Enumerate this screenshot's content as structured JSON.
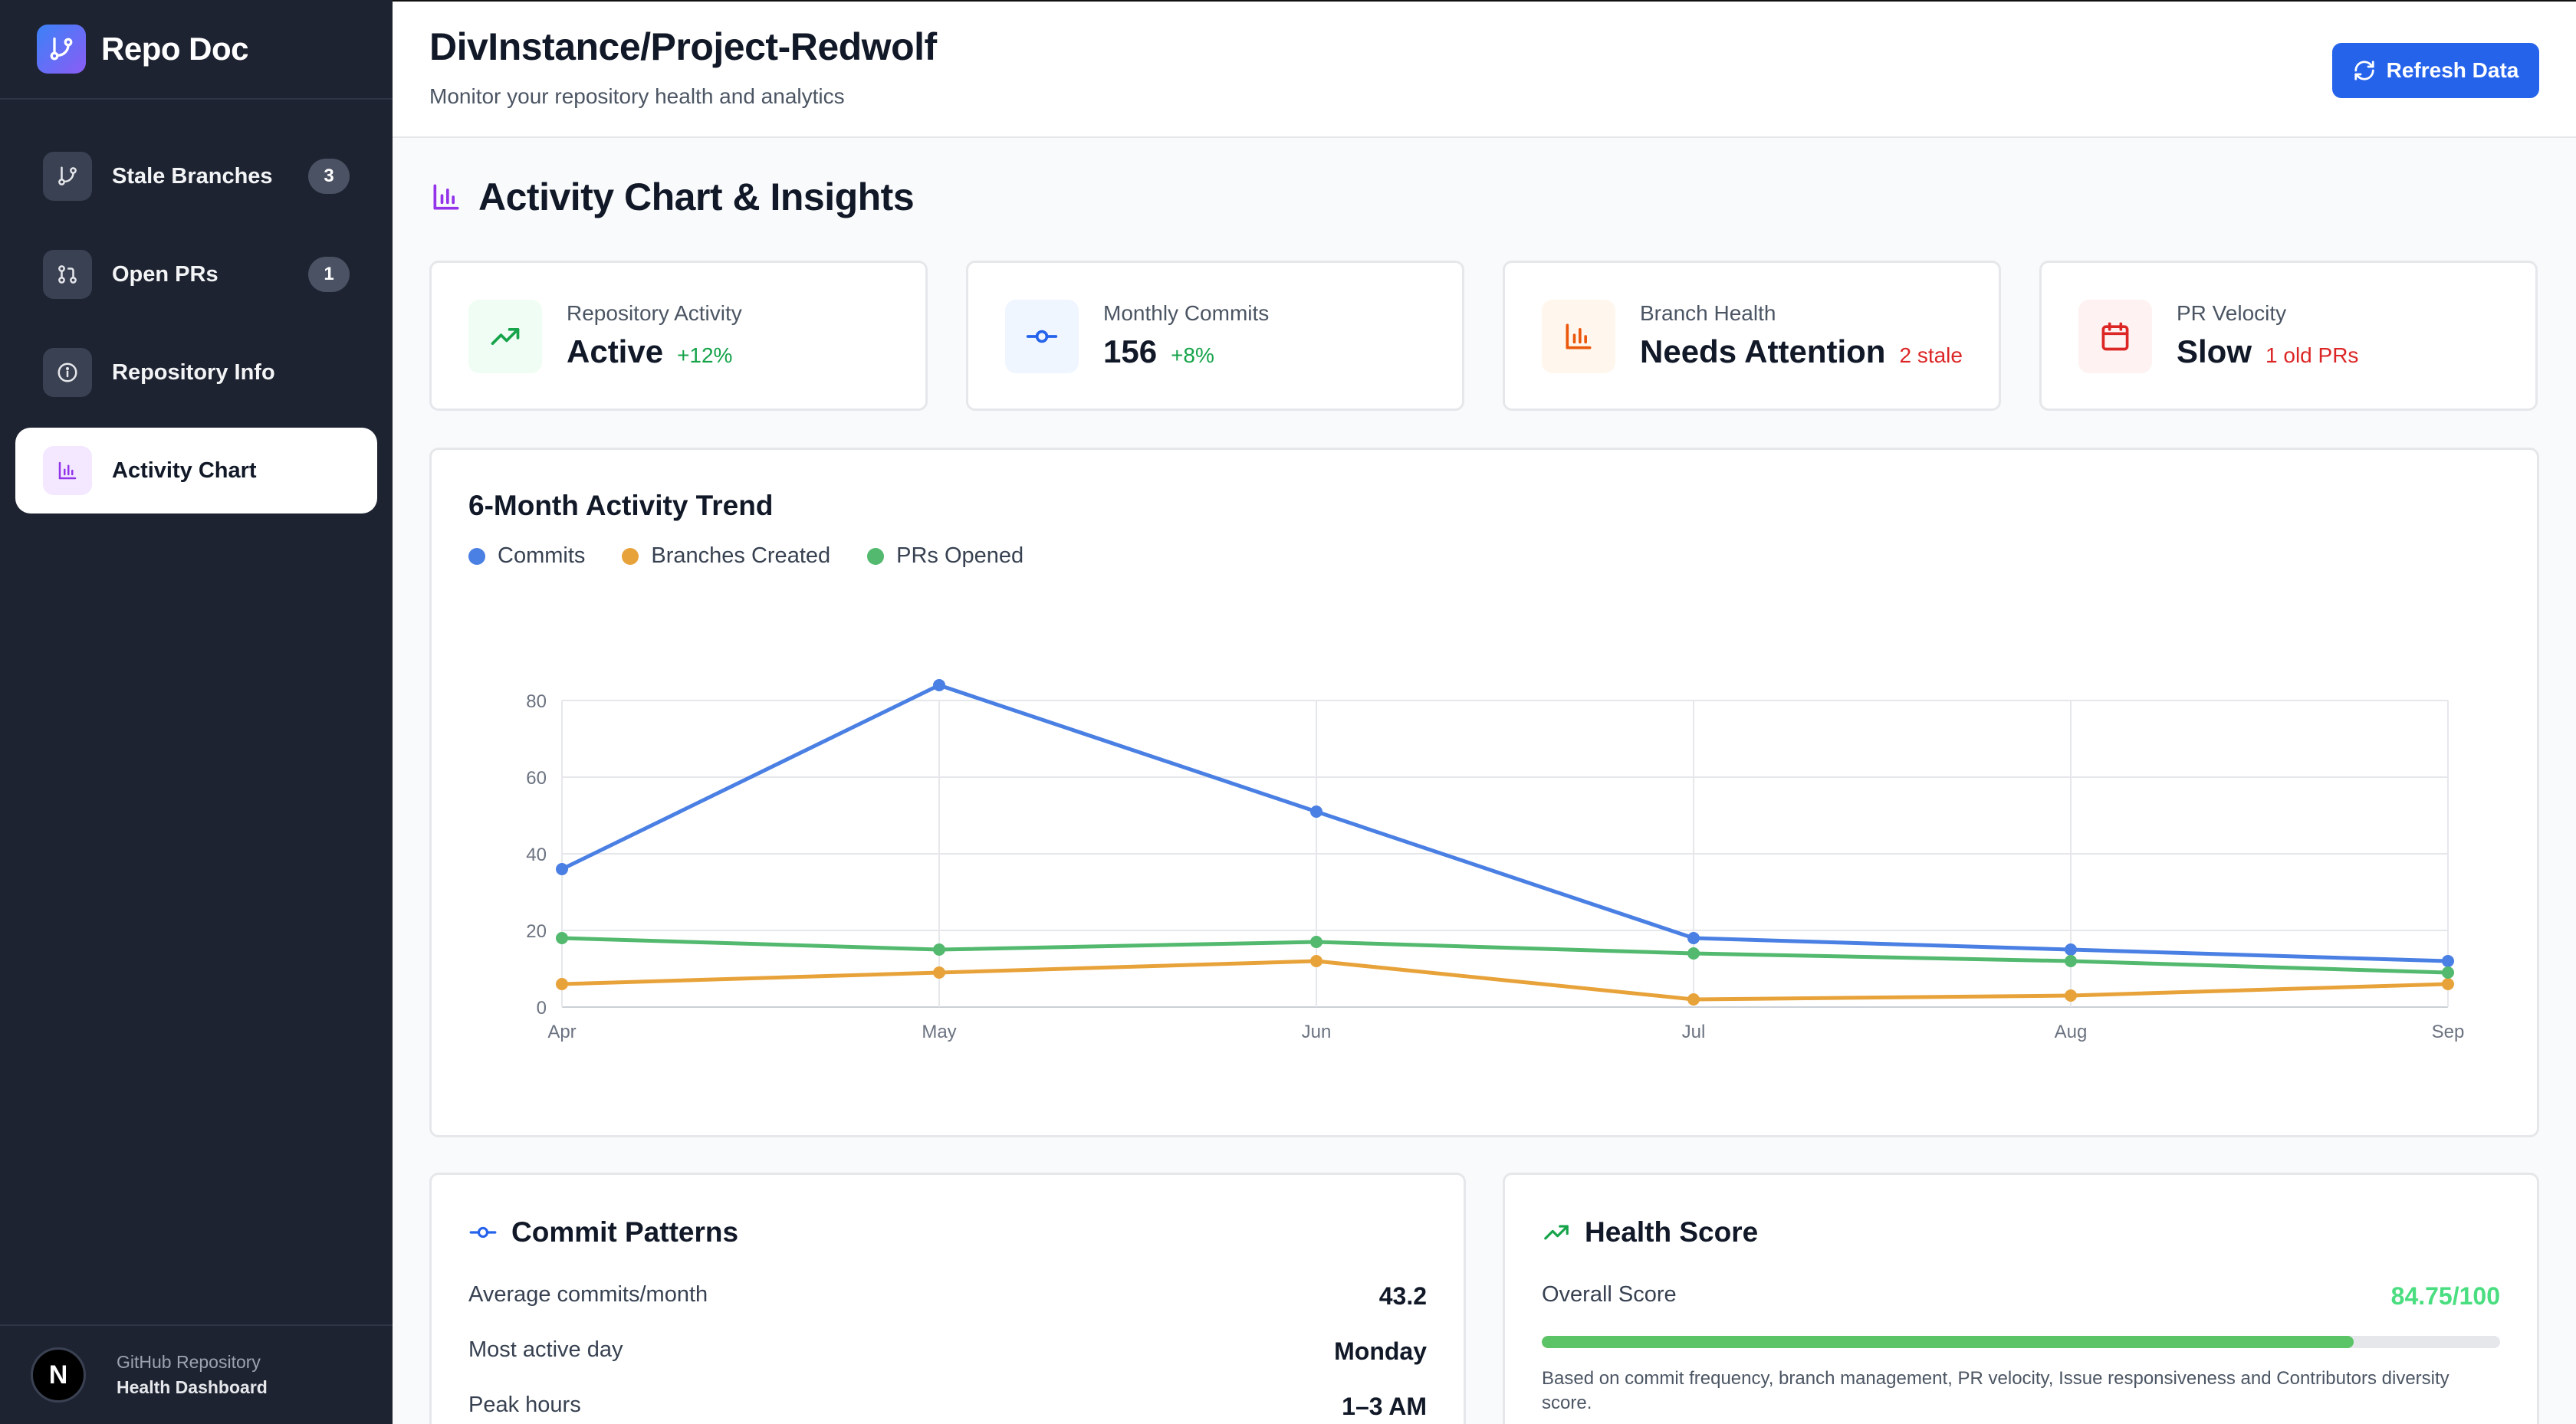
{
  "app": {
    "name": "Repo Doc"
  },
  "sidebar": {
    "items": [
      {
        "label": "Stale Branches",
        "badge": "3",
        "icon": "git-branch-icon"
      },
      {
        "label": "Open PRs",
        "badge": "1",
        "icon": "git-pull-request-icon"
      },
      {
        "label": "Repository Info",
        "icon": "info-icon"
      },
      {
        "label": "Activity Chart",
        "icon": "bar-chart-icon",
        "active": true
      }
    ],
    "footer": {
      "avatar_letter": "N",
      "line1": "GitHub Repository",
      "line2": "Health Dashboard"
    }
  },
  "header": {
    "title": "DivInstance/Project-Redwolf",
    "subtitle": "Monitor your repository health and analytics",
    "refresh_label": "Refresh Data"
  },
  "section": {
    "title": "Activity Chart & Insights"
  },
  "stats": [
    {
      "label": "Repository Activity",
      "value": "Active",
      "delta": "+12%",
      "delta_color": "#16a34a",
      "icon": "trending-up-icon",
      "icon_bg": "#f0fdf4",
      "icon_color": "#16a34a"
    },
    {
      "label": "Monthly Commits",
      "value": "156",
      "delta": "+8%",
      "delta_color": "#16a34a",
      "icon": "git-commit-icon",
      "icon_bg": "#eff6ff",
      "icon_color": "#2563eb"
    },
    {
      "label": "Branch Health",
      "value": "Needs Attention",
      "delta": "2 stale",
      "delta_color": "#dc2626",
      "icon": "bar-chart-icon",
      "icon_bg": "#fff7ed",
      "icon_color": "#ea580c"
    },
    {
      "label": "PR Velocity",
      "value": "Slow",
      "delta": "1 old PRs",
      "delta_color": "#dc2626",
      "icon": "calendar-icon",
      "icon_bg": "#fef2f2",
      "icon_color": "#dc2626"
    }
  ],
  "chart_data": {
    "type": "line",
    "title": "6-Month Activity Trend",
    "categories": [
      "Apr",
      "May",
      "Jun",
      "Jul",
      "Aug",
      "Sep"
    ],
    "ylim": [
      0,
      80
    ],
    "yticks": [
      0,
      20,
      40,
      60,
      80
    ],
    "grid": true,
    "legend": "top-left",
    "series": [
      {
        "name": "Commits",
        "color": "#4a7fe3",
        "values": [
          36,
          84,
          51,
          18,
          15,
          12
        ]
      },
      {
        "name": "Branches Created",
        "color": "#e8a23a",
        "values": [
          6,
          9,
          12,
          2,
          3,
          6
        ]
      },
      {
        "name": "PRs Opened",
        "color": "#52b96e",
        "values": [
          18,
          15,
          17,
          14,
          12,
          9
        ]
      }
    ]
  },
  "commit_patterns": {
    "title": "Commit Patterns",
    "rows": [
      {
        "label": "Average commits/month",
        "value": "43.2"
      },
      {
        "label": "Most active day",
        "value": "Monday"
      },
      {
        "label": "Peak hours",
        "value": "1–3 AM"
      }
    ]
  },
  "health_score": {
    "title": "Health Score",
    "label": "Overall Score",
    "value": "84.75/100",
    "percent": 84.75,
    "note": "Based on commit frequency, branch management, PR velocity, Issue responsiveness and Contributors diversity score."
  }
}
